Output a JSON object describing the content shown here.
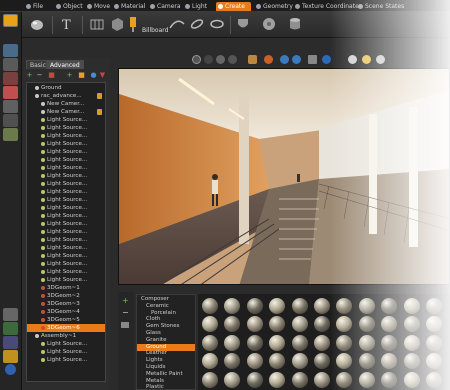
{
  "menu": {
    "tabs": [
      {
        "label": "File",
        "icon": "file-icon",
        "active": false
      },
      {
        "label": "Object",
        "icon": "object-icon",
        "active": false
      },
      {
        "label": "Move",
        "icon": "move-icon",
        "active": false
      },
      {
        "label": "Material",
        "icon": "material-icon",
        "active": false
      },
      {
        "label": "Camera",
        "icon": "camera-icon",
        "active": false
      },
      {
        "label": "Light",
        "icon": "light-icon",
        "active": false
      },
      {
        "label": "Create",
        "icon": "create-icon",
        "active": true
      },
      {
        "label": "Geometry",
        "icon": "geometry-icon",
        "active": false
      },
      {
        "label": "Texture Coordinates",
        "icon": "texture-icon",
        "active": false
      },
      {
        "label": "Scene States",
        "icon": "scene-states-icon",
        "active": false
      }
    ]
  },
  "ribbon": {
    "billboard_label": "Billboard"
  },
  "scene_panel": {
    "tabs": [
      "Basic",
      "Advanced"
    ],
    "active_tab": "Advanced",
    "tree": [
      {
        "label": "Ground",
        "indent": 0,
        "locked": false,
        "selected": false
      },
      {
        "label": "rac_advance...",
        "indent": 0,
        "locked": true,
        "selected": false
      },
      {
        "label": "New Camer...",
        "indent": 1,
        "locked": false,
        "selected": false
      },
      {
        "label": "New Camer...",
        "indent": 1,
        "locked": true,
        "selected": false
      },
      {
        "label": "Light Source...",
        "indent": 1,
        "locked": false,
        "selected": false
      },
      {
        "label": "Light Source...",
        "indent": 1,
        "locked": false,
        "selected": false
      },
      {
        "label": "Light Source...",
        "indent": 1,
        "locked": false,
        "selected": false
      },
      {
        "label": "Light Source...",
        "indent": 1,
        "locked": false,
        "selected": false
      },
      {
        "label": "Light Source...",
        "indent": 1,
        "locked": false,
        "selected": false
      },
      {
        "label": "Light Source...",
        "indent": 1,
        "locked": false,
        "selected": false
      },
      {
        "label": "Light Source...",
        "indent": 1,
        "locked": false,
        "selected": false
      },
      {
        "label": "Light Source...",
        "indent": 1,
        "locked": false,
        "selected": false
      },
      {
        "label": "Light Source...",
        "indent": 1,
        "locked": false,
        "selected": false
      },
      {
        "label": "Light Source...",
        "indent": 1,
        "locked": false,
        "selected": false
      },
      {
        "label": "Light Source...",
        "indent": 1,
        "locked": false,
        "selected": false
      },
      {
        "label": "Light Source...",
        "indent": 1,
        "locked": false,
        "selected": false
      },
      {
        "label": "Light Source...",
        "indent": 1,
        "locked": false,
        "selected": false
      },
      {
        "label": "Light Source...",
        "indent": 1,
        "locked": false,
        "selected": false
      },
      {
        "label": "Light Source...",
        "indent": 1,
        "locked": false,
        "selected": false
      },
      {
        "label": "Light Source...",
        "indent": 1,
        "locked": false,
        "selected": false
      },
      {
        "label": "Light Source...",
        "indent": 1,
        "locked": false,
        "selected": false
      },
      {
        "label": "Light Source...",
        "indent": 1,
        "locked": false,
        "selected": false
      },
      {
        "label": "Light Source...",
        "indent": 1,
        "locked": false,
        "selected": false
      },
      {
        "label": "Light Source...",
        "indent": 1,
        "locked": false,
        "selected": false
      },
      {
        "label": "Light Source...",
        "indent": 1,
        "locked": false,
        "selected": false
      },
      {
        "label": "3DGeom~1",
        "indent": 1,
        "locked": false,
        "selected": false
      },
      {
        "label": "3DGeom~2",
        "indent": 1,
        "locked": false,
        "selected": false
      },
      {
        "label": "3DGeom~3",
        "indent": 1,
        "locked": false,
        "selected": false
      },
      {
        "label": "3DGeom~4",
        "indent": 1,
        "locked": false,
        "selected": false
      },
      {
        "label": "3DGeom~5",
        "indent": 1,
        "locked": false,
        "selected": false
      },
      {
        "label": "3DGeom~6",
        "indent": 1,
        "locked": false,
        "selected": true
      },
      {
        "label": "Assembly~1",
        "indent": 0,
        "locked": false,
        "selected": false
      },
      {
        "label": "Light Source...",
        "indent": 1,
        "locked": false,
        "selected": false
      },
      {
        "label": "Light Source...",
        "indent": 1,
        "locked": false,
        "selected": false
      },
      {
        "label": "Light Source...",
        "indent": 1,
        "locked": false,
        "selected": false
      }
    ]
  },
  "materials": {
    "categories": [
      {
        "label": "Composer",
        "indent": 0,
        "selected": false
      },
      {
        "label": "Ceramic",
        "indent": 1,
        "selected": false
      },
      {
        "label": "Porcelain",
        "indent": 2,
        "selected": false
      },
      {
        "label": "Cloth",
        "indent": 1,
        "selected": false
      },
      {
        "label": "Gem Stones",
        "indent": 1,
        "selected": false
      },
      {
        "label": "Glass",
        "indent": 1,
        "selected": false
      },
      {
        "label": "Granite",
        "indent": 1,
        "selected": false
      },
      {
        "label": "Ground",
        "indent": 1,
        "selected": true
      },
      {
        "label": "Leather",
        "indent": 1,
        "selected": false
      },
      {
        "label": "Lights",
        "indent": 1,
        "selected": false
      },
      {
        "label": "Liquids",
        "indent": 1,
        "selected": false
      },
      {
        "label": "Metallic Paint",
        "indent": 1,
        "selected": false
      },
      {
        "label": "Metals",
        "indent": 1,
        "selected": false
      },
      {
        "label": "Plastic",
        "indent": 1,
        "selected": false
      }
    ],
    "thumbnail_columns": 11,
    "thumbnail_rows": 5
  },
  "colors": {
    "accent": "#e87b1a",
    "panel": "#2d2d2d",
    "tree_bg": "#202020"
  }
}
